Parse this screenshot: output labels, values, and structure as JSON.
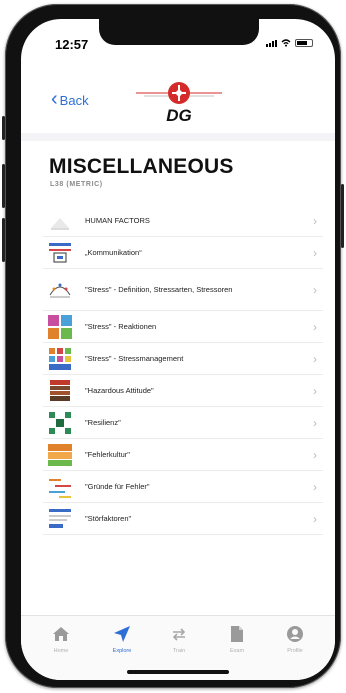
{
  "status_bar": {
    "time": "12:57"
  },
  "nav": {
    "back_label": "Back",
    "logo_text": "DG"
  },
  "page": {
    "title": "MISCELLANEOUS",
    "subtitle": "L38 (METRIC)"
  },
  "items": [
    {
      "label": "HUMAN FACTORS"
    },
    {
      "label": "„Kommunikation“"
    },
    {
      "label": "\"Stress\" - Definition, Stressarten, Stressoren"
    },
    {
      "label": "\"Stress\" - Reaktionen"
    },
    {
      "label": "\"Stress\" - Stressmanagement"
    },
    {
      "label": "\"Hazardous Attitude\""
    },
    {
      "label": "\"Resilienz\""
    },
    {
      "label": "\"Fehlerkultur\""
    },
    {
      "label": "\"Gründe für Fehler\""
    },
    {
      "label": "\"Störfaktoren\""
    }
  ],
  "tabs": [
    {
      "label": "Home",
      "icon": "home-icon"
    },
    {
      "label": "Explore",
      "icon": "paper-plane-icon",
      "active": true
    },
    {
      "label": "Train",
      "icon": "repeat-icon"
    },
    {
      "label": "Exam",
      "icon": "document-icon"
    },
    {
      "label": "Profile",
      "icon": "profile-icon"
    }
  ],
  "colors": {
    "accent": "#2d6fd6",
    "logo_red": "#d42a2a"
  }
}
